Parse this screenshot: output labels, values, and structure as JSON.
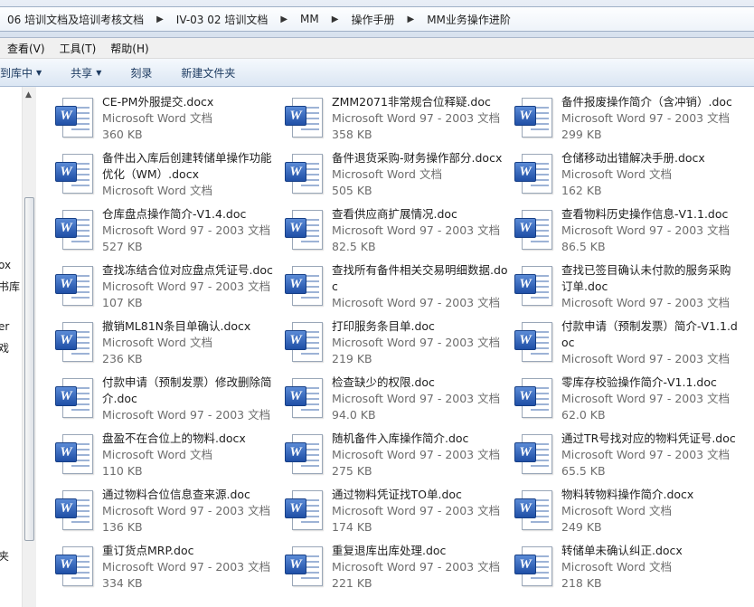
{
  "breadcrumb": [
    "06 培训文档及培训考核文档",
    "IV-03 02 培训文档",
    "MM",
    "操作手册",
    "MM业务操作进阶"
  ],
  "menu": [
    "查看(V)",
    "工具(T)",
    "帮助(H)"
  ],
  "commands": [
    {
      "label": "到库中",
      "dropdown": true
    },
    {
      "label": "共享",
      "dropdown": true
    },
    {
      "label": "刻录",
      "dropdown": false
    },
    {
      "label": "新建文件夹",
      "dropdown": false
    }
  ],
  "nav_fragments": [
    "ox",
    "书库",
    "er",
    "戏",
    "夹"
  ],
  "icon": {
    "badge_letter": "W",
    "name": "word-document-icon"
  },
  "files": [
    {
      "name": "CE-PM外服提交.docx",
      "type": "Microsoft Word 文档",
      "size": "360 KB"
    },
    {
      "name": "ZMM2071非常规合位释疑.doc",
      "type": "Microsoft Word 97 - 2003 文档",
      "size": "358 KB"
    },
    {
      "name": "备件报废操作简介（含冲销）.doc",
      "type": "Microsoft Word 97 - 2003 文档",
      "size": "299 KB"
    },
    {
      "name": "备件出入库后创建转储单操作功能优化（WM）.docx",
      "type": "Microsoft Word 文档",
      "size": ""
    },
    {
      "name": "备件退货采购-财务操作部分.docx",
      "type": "Microsoft Word 文档",
      "size": "505 KB"
    },
    {
      "name": "仓储移动出错解决手册.docx",
      "type": "Microsoft Word 文档",
      "size": "162 KB"
    },
    {
      "name": "仓库盘点操作简介-V1.4.doc",
      "type": "Microsoft Word 97 - 2003 文档",
      "size": "527 KB"
    },
    {
      "name": "查看供应商扩展情况.doc",
      "type": "Microsoft Word 97 - 2003 文档",
      "size": "82.5 KB"
    },
    {
      "name": "查看物料历史操作信息-V1.1.doc",
      "type": "Microsoft Word 97 - 2003 文档",
      "size": "86.5 KB"
    },
    {
      "name": "查找冻结合位对应盘点凭证号.doc",
      "type": "Microsoft Word 97 - 2003 文档",
      "size": "107 KB"
    },
    {
      "name": "查找所有备件相关交易明细数据.doc",
      "type": "Microsoft Word 97 - 2003 文档",
      "size": ""
    },
    {
      "name": "查找已签目确认未付款的服务采购订单.doc",
      "type": "Microsoft Word 97 - 2003 文档",
      "size": ""
    },
    {
      "name": "撤销ML81N条目单确认.docx",
      "type": "Microsoft Word 文档",
      "size": "236 KB"
    },
    {
      "name": "打印服务条目单.doc",
      "type": "Microsoft Word 97 - 2003 文档",
      "size": "219 KB"
    },
    {
      "name": "付款申请（预制发票）简介-V1.1.doc",
      "type": "Microsoft Word 97 - 2003 文档",
      "size": ""
    },
    {
      "name": "付款申请（预制发票）修改删除简介.doc",
      "type": "Microsoft Word 97 - 2003 文档",
      "size": ""
    },
    {
      "name": "检查缺少的权限.doc",
      "type": "Microsoft Word 97 - 2003 文档",
      "size": "94.0 KB"
    },
    {
      "name": "零库存校验操作简介-V1.1.doc",
      "type": "Microsoft Word 97 - 2003 文档",
      "size": "62.0 KB"
    },
    {
      "name": "盘盈不在合位上的物料.docx",
      "type": "Microsoft Word 文档",
      "size": "110 KB"
    },
    {
      "name": "随机备件入库操作简介.doc",
      "type": "Microsoft Word 97 - 2003 文档",
      "size": "275 KB"
    },
    {
      "name": "通过TR号找对应的物料凭证号.doc",
      "type": "Microsoft Word 97 - 2003 文档",
      "size": "65.5 KB"
    },
    {
      "name": "通过物料合位信息查来源.doc",
      "type": "Microsoft Word 97 - 2003 文档",
      "size": "136 KB"
    },
    {
      "name": "通过物料凭证找TO单.doc",
      "type": "Microsoft Word 97 - 2003 文档",
      "size": "174 KB"
    },
    {
      "name": "物料转物料操作简介.docx",
      "type": "Microsoft Word 文档",
      "size": "249 KB"
    },
    {
      "name": "重订货点MRP.doc",
      "type": "Microsoft Word 97 - 2003 文档",
      "size": "334 KB"
    },
    {
      "name": "重复退库出库处理.doc",
      "type": "Microsoft Word 97 - 2003 文档",
      "size": "221 KB"
    },
    {
      "name": "转储单未确认纠正.docx",
      "type": "Microsoft Word 文档",
      "size": "218 KB"
    }
  ]
}
